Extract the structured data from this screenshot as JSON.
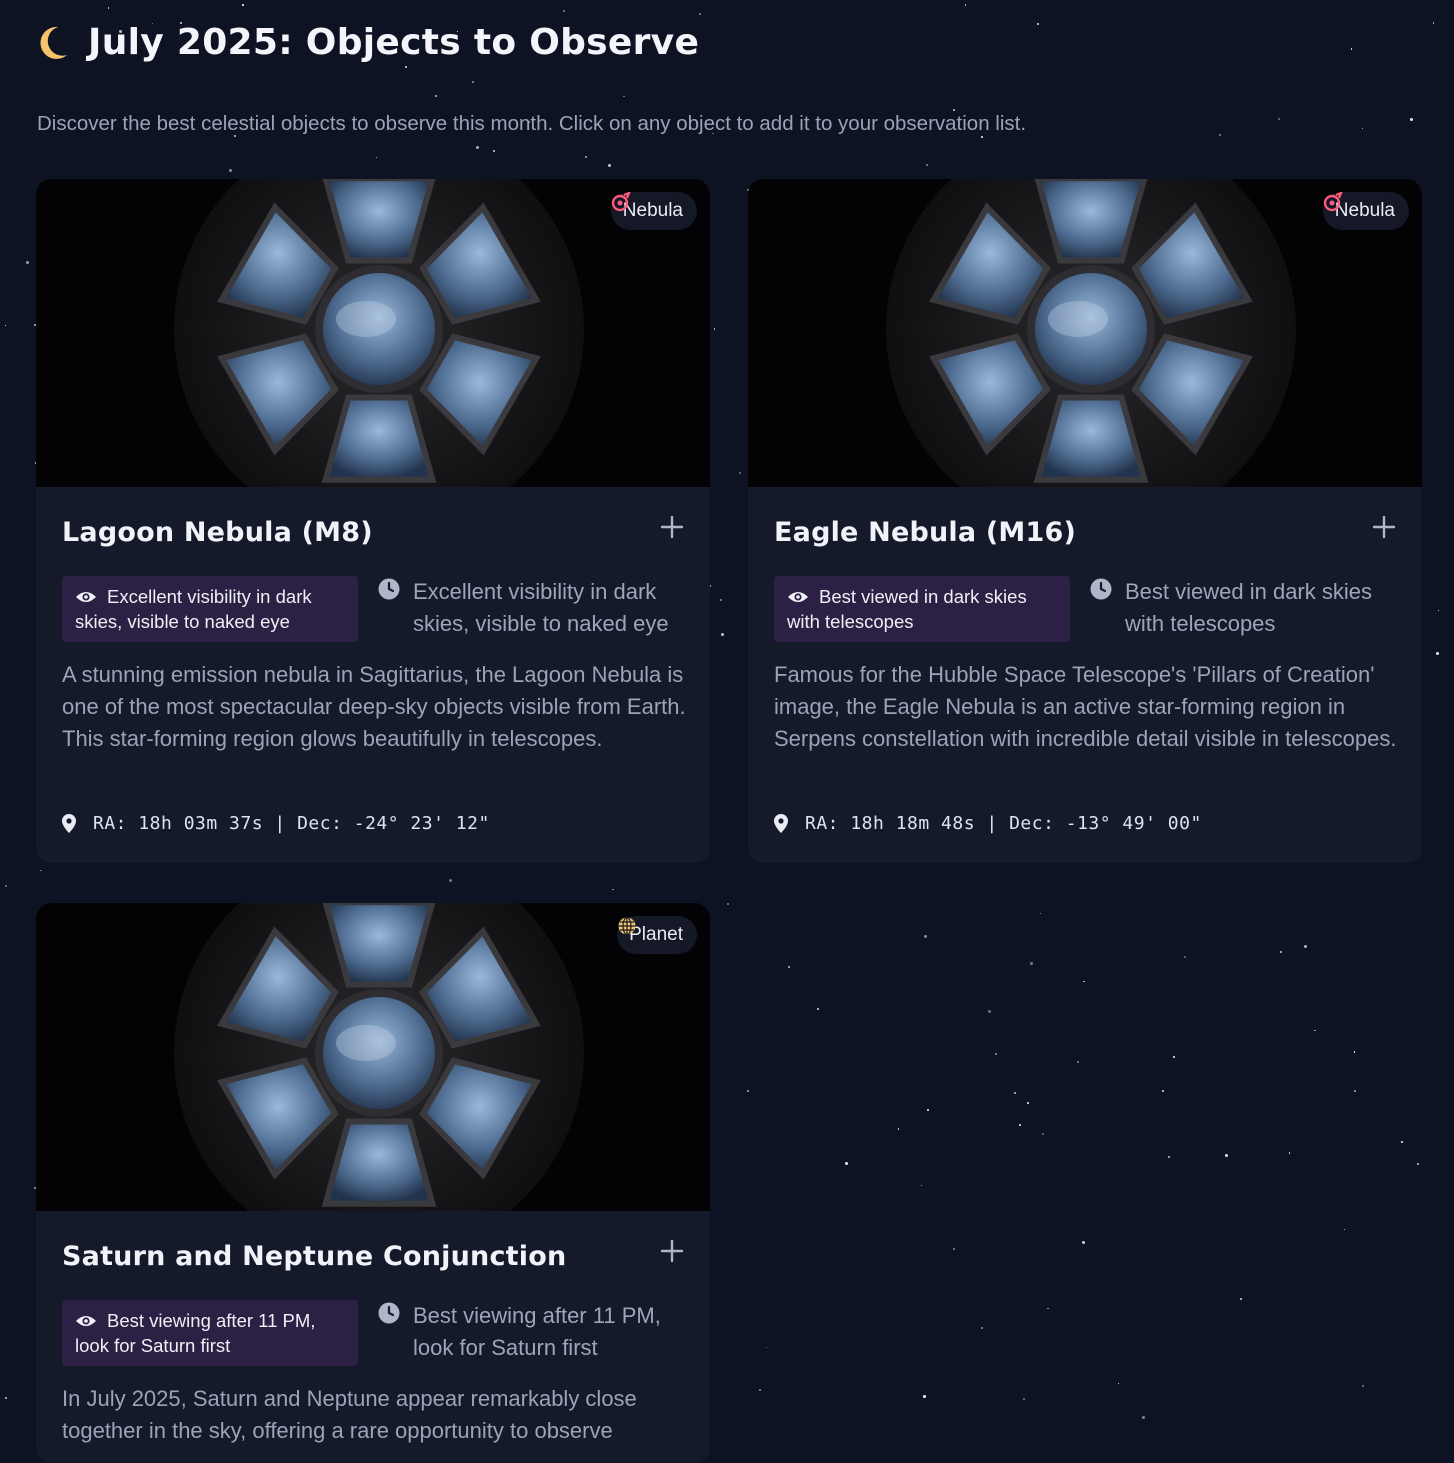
{
  "header": {
    "title": "July 2025: Objects to Observe",
    "subtitle": "Discover the best celestial objects to observe this month. Click on any object to add it to your observation list.",
    "icon": "moon-icon",
    "accent_color": "#f5c46a"
  },
  "cards": [
    {
      "title": "Lagoon Nebula (M8)",
      "badge": {
        "label": "Nebula",
        "icon": "nebula-icon",
        "color": "#ff5a7a"
      },
      "visibility": "Excellent visibility in dark skies, visible to naked eye",
      "best_time": "Excellent visibility in dark skies, visible to naked eye",
      "description": "A stunning emission nebula in Sagittarius, the Lagoon Nebula is one of the most spectacular deep-sky objects visible from Earth. This star-forming region glows beautifully in telescopes.",
      "coordinates": "RA: 18h 03m 37s | Dec: -24° 23' 12\"",
      "add_icon": "plus-icon"
    },
    {
      "title": "Eagle Nebula (M16)",
      "badge": {
        "label": "Nebula",
        "icon": "nebula-icon",
        "color": "#ff5a7a"
      },
      "visibility": "Best viewed in dark skies with telescopes",
      "best_time": "Best viewed in dark skies with telescopes",
      "description": "Famous for the Hubble Space Telescope's 'Pillars of Creation' image, the Eagle Nebula is an active star-forming region in Serpens constellation with incredible detail visible in telescopes.",
      "coordinates": "RA: 18h 18m 48s | Dec: -13° 49' 00\"",
      "add_icon": "plus-icon"
    },
    {
      "title": "Saturn and Neptune Conjunction",
      "badge": {
        "label": "Planet",
        "icon": "globe-icon",
        "color": "#f5c46a"
      },
      "visibility": "Best viewing after 11 PM, look for Saturn first",
      "best_time": "Best viewing after 11 PM, look for Saturn first",
      "description": "In July 2025, Saturn and Neptune appear remarkably close together in the sky, offering a rare opportunity to observe",
      "coordinates": "",
      "add_icon": "plus-icon"
    }
  ]
}
